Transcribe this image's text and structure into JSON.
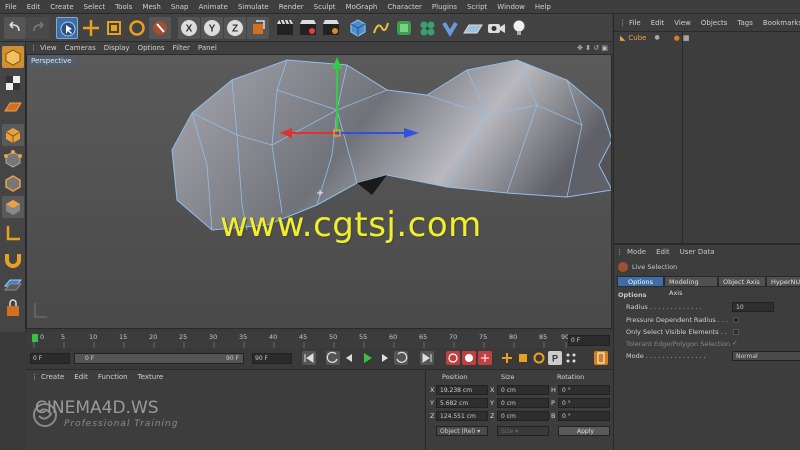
{
  "menu": [
    "File",
    "Edit",
    "Create",
    "Select",
    "Tools",
    "Mesh",
    "Snap",
    "Animate",
    "Simulate",
    "Render",
    "Sculpt",
    "MoGraph",
    "Character",
    "Plugins",
    "Script",
    "Window",
    "Help"
  ],
  "toolbar": {
    "xyz": [
      "X",
      "Y",
      "Z"
    ]
  },
  "viewport": {
    "menu": [
      "View",
      "Cameras",
      "Display",
      "Options",
      "Filter",
      "Panel"
    ],
    "label": "Perspective"
  },
  "timeline": {
    "ticks": [
      "0",
      "5",
      "10",
      "15",
      "20",
      "25",
      "30",
      "35",
      "40",
      "45",
      "50",
      "55",
      "60",
      "65",
      "70",
      "75",
      "80",
      "85",
      "90"
    ],
    "end_frame": "0 F",
    "current": "0 F",
    "min": "0 F",
    "max": "90 F",
    "preview_max": "90 F"
  },
  "materials": {
    "menu": [
      "Create",
      "Edit",
      "Function",
      "Texture"
    ]
  },
  "coords": {
    "headers": [
      "Position",
      "Size",
      "Rotation"
    ],
    "rows": [
      {
        "axis": "X",
        "pos": "19.238 cm",
        "size_axis": "X",
        "size": "0 cm",
        "rot_axis": "H",
        "rot": "0 °"
      },
      {
        "axis": "Y",
        "pos": "5.682 cm",
        "size_axis": "Y",
        "size": "0 cm",
        "rot_axis": "P",
        "rot": "0 °"
      },
      {
        "axis": "Z",
        "pos": "124.551 cm",
        "size_axis": "Z",
        "size": "0 cm",
        "rot_axis": "B",
        "rot": "0 °"
      }
    ],
    "mode": "Object (Rel)",
    "size_mode": "Size",
    "apply": "Apply"
  },
  "objects": {
    "menu": [
      "File",
      "Edit",
      "View",
      "Objects",
      "Tags",
      "Bookmarks"
    ],
    "items": [
      {
        "name": "Cube"
      }
    ]
  },
  "attributes": {
    "menu": [
      "Mode",
      "Edit",
      "User Data"
    ],
    "tool_name": "Live Selection",
    "tabs": [
      "Options",
      "Modeling Axis",
      "Object Axis",
      "HyperNU"
    ],
    "section": "Options",
    "radius_label": "Radius . . . . . . . . . . . . .",
    "radius_value": "10",
    "pressure_label": "Pressure Dependent Radius . . .",
    "visible_label": "Only Select Visible Elements . .",
    "tolerant_label": "Tolerant Edge/Polygon Selection",
    "mode_label": "Mode . . . . . . . . . . . . . . .",
    "mode_value": "Normal"
  },
  "watermark": {
    "url": "www.cgtsj.com",
    "logo": "CINEMA4D.WS",
    "tagline": "Professional Training"
  },
  "colors": {
    "accent_blue": "#4a8fd0",
    "watermark_yellow": "#f2ef2a",
    "active_tab": "#3d6fa6"
  }
}
